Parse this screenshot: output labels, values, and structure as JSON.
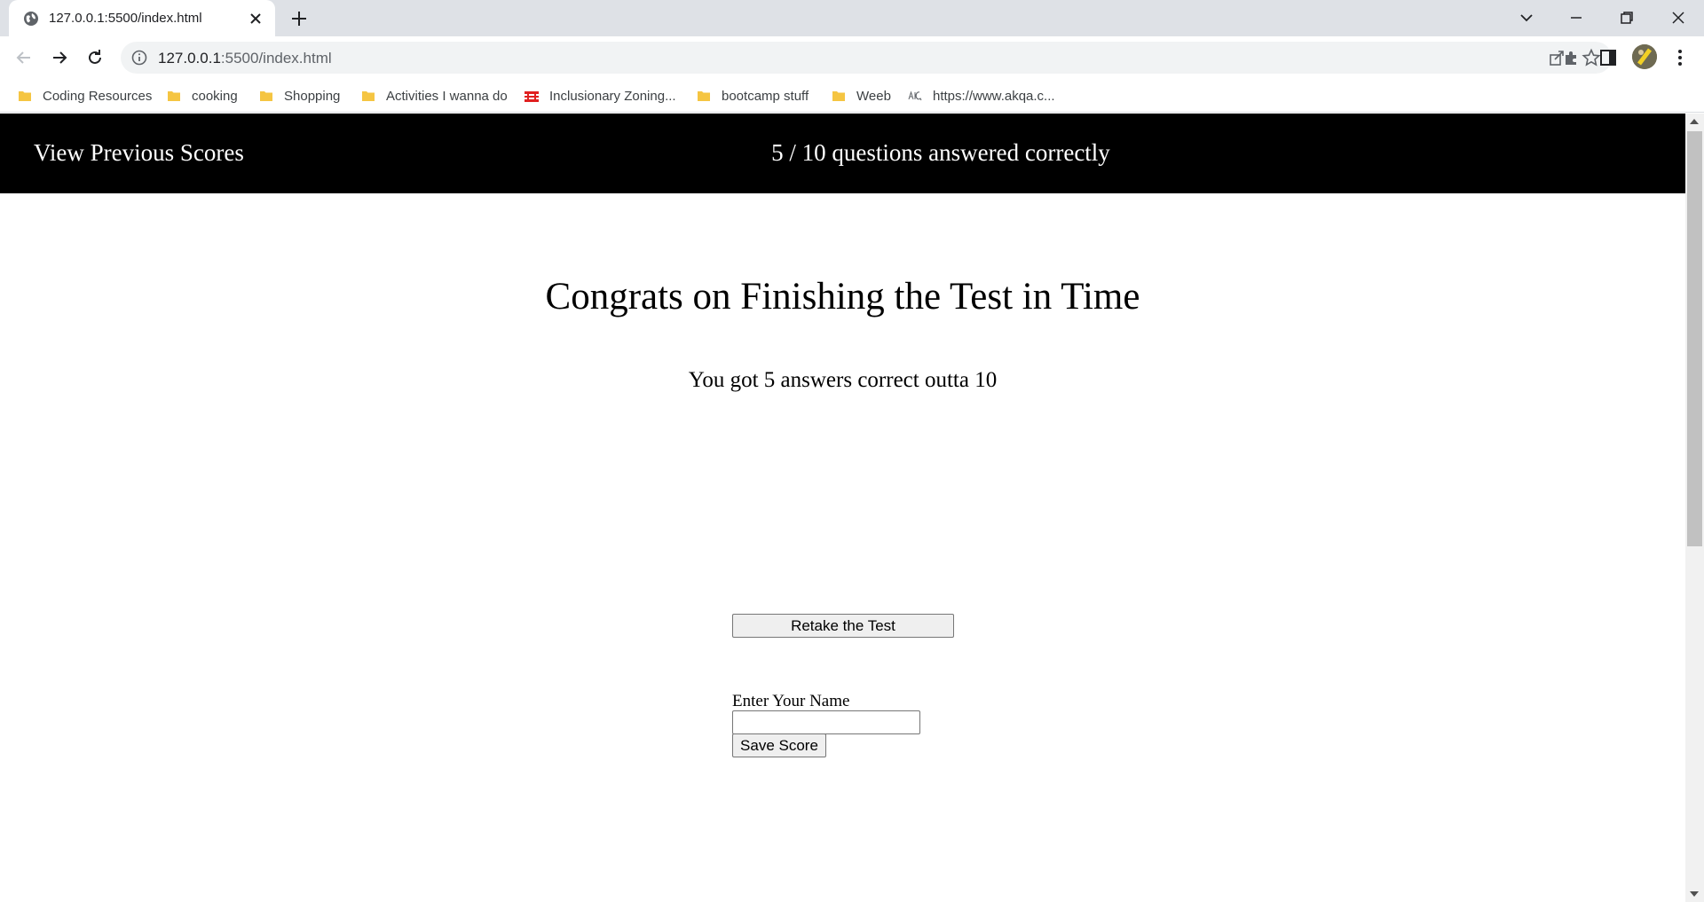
{
  "browser": {
    "tab": {
      "title": "127.0.0.1:5500/index.html",
      "favicon": "globe-icon"
    },
    "address": {
      "host": "127.0.0.1",
      "path": ":5500/index.html"
    },
    "bookmarks": [
      {
        "label": "Coding Resources",
        "icon": "folder-icon"
      },
      {
        "label": "cooking",
        "icon": "folder-icon"
      },
      {
        "label": "Shopping",
        "icon": "folder-icon"
      },
      {
        "label": "Activities I wanna do",
        "icon": "folder-icon"
      },
      {
        "label": "Inclusionary Zoning...",
        "icon": "site-icon-red"
      },
      {
        "label": "bootcamp stuff",
        "icon": "folder-icon"
      },
      {
        "label": "Weeb",
        "icon": "folder-icon"
      },
      {
        "label": "https://www.akqa.c...",
        "icon": "akqa-icon"
      }
    ],
    "colors": {
      "tabstrip": "#dee1e6",
      "omnibox": "#f1f3f4",
      "folder": "#f5c542"
    }
  },
  "page": {
    "header": {
      "view_previous": "View Previous Scores",
      "score_summary": "5 / 10 questions answered correctly"
    },
    "heading": "Congrats on Finishing the Test in Time",
    "result": "You got 5 answers correct outta 10",
    "retake_label": "Retake the Test",
    "name_label": "Enter Your Name",
    "name_value": "",
    "save_label": "Save Score",
    "colors": {
      "header_bg": "#000000",
      "header_text": "#ffffff"
    }
  }
}
